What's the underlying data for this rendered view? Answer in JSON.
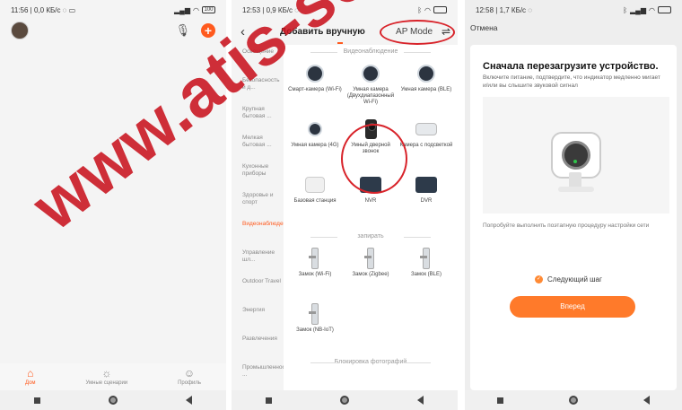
{
  "phone1": {
    "status": {
      "time": "11:56",
      "speed": "0,0 КБ/с",
      "battery": "100"
    },
    "tabs": [
      {
        "label": "Дом",
        "active": true
      },
      {
        "label": "Умные сценарии",
        "active": false
      },
      {
        "label": "Профиль",
        "active": false
      }
    ],
    "accent": "#ff5a1e"
  },
  "phone2": {
    "status": {
      "time": "12:53",
      "speed": "0,9 КБ/с"
    },
    "title": "Добавить вручную",
    "ap_mode": "AP Mode",
    "sidebar": [
      {
        "label": "Освещение",
        "active": false
      },
      {
        "label": "Безопасность и д...",
        "active": false
      },
      {
        "label": "Крупная бытовая ...",
        "active": false
      },
      {
        "label": "Мелкая бытовая ...",
        "active": false
      },
      {
        "label": "Кухонные приборы",
        "active": false
      },
      {
        "label": "Здоровье и спорт",
        "active": false
      },
      {
        "label": "Видеонаблюдение",
        "active": true
      },
      {
        "label": "Управление шл...",
        "active": false
      },
      {
        "label": "Outdoor Travel",
        "active": false
      },
      {
        "label": "Энергия",
        "active": false
      },
      {
        "label": "Развлечения",
        "active": false
      },
      {
        "label": "Промышленность ...",
        "active": false
      }
    ],
    "sections": [
      {
        "title": "Видеонаблюдение",
        "devices": [
          {
            "label": "Смарт-камера (Wi-Fi)",
            "icon": "camera-icon"
          },
          {
            "label": "Умная камера (Двухдиапазонный Wi-Fi)",
            "icon": "camera-icon"
          },
          {
            "label": "Умная камера (BLE)",
            "icon": "camera-icon"
          },
          {
            "label": "Умная камера (4G)",
            "icon": "camera-icon"
          },
          {
            "label": "Умный дверной звонок",
            "icon": "doorbell-icon"
          },
          {
            "label": "Камера с подсветкой",
            "icon": "floodlight-camera-icon"
          },
          {
            "label": "Базовая станция",
            "icon": "base-station-icon"
          },
          {
            "label": "NVR",
            "icon": "nvr-icon"
          },
          {
            "label": "DVR",
            "icon": "dvr-icon"
          }
        ]
      },
      {
        "title": "запирать",
        "devices": [
          {
            "label": "Замок (Wi-Fi)",
            "icon": "lock-icon"
          },
          {
            "label": "Замок (Zigbee)",
            "icon": "lock-icon"
          },
          {
            "label": "Замок (BLE)",
            "icon": "lock-icon"
          },
          {
            "label": "Замок (NB-IoT)",
            "icon": "lock-icon"
          }
        ]
      },
      {
        "title": "Блокировка фотографий",
        "devices": []
      }
    ]
  },
  "phone3": {
    "status": {
      "time": "12:58",
      "speed": "1,7 КБ/с"
    },
    "cancel": "Отмена",
    "title": "Сначала перезагрузите устройство.",
    "description": "Включите питание, подтвердите, что индикатор медленно мигает и/или вы слышите звуковой сигнал",
    "alt_text": "Попробуйте выполнить поэтапную процедуру настройки сети",
    "checkbox_label": "Следующий шаг",
    "next_button": "Вперед",
    "accent": "#ff7a2a"
  },
  "watermark": "www.atis-sec.ru"
}
